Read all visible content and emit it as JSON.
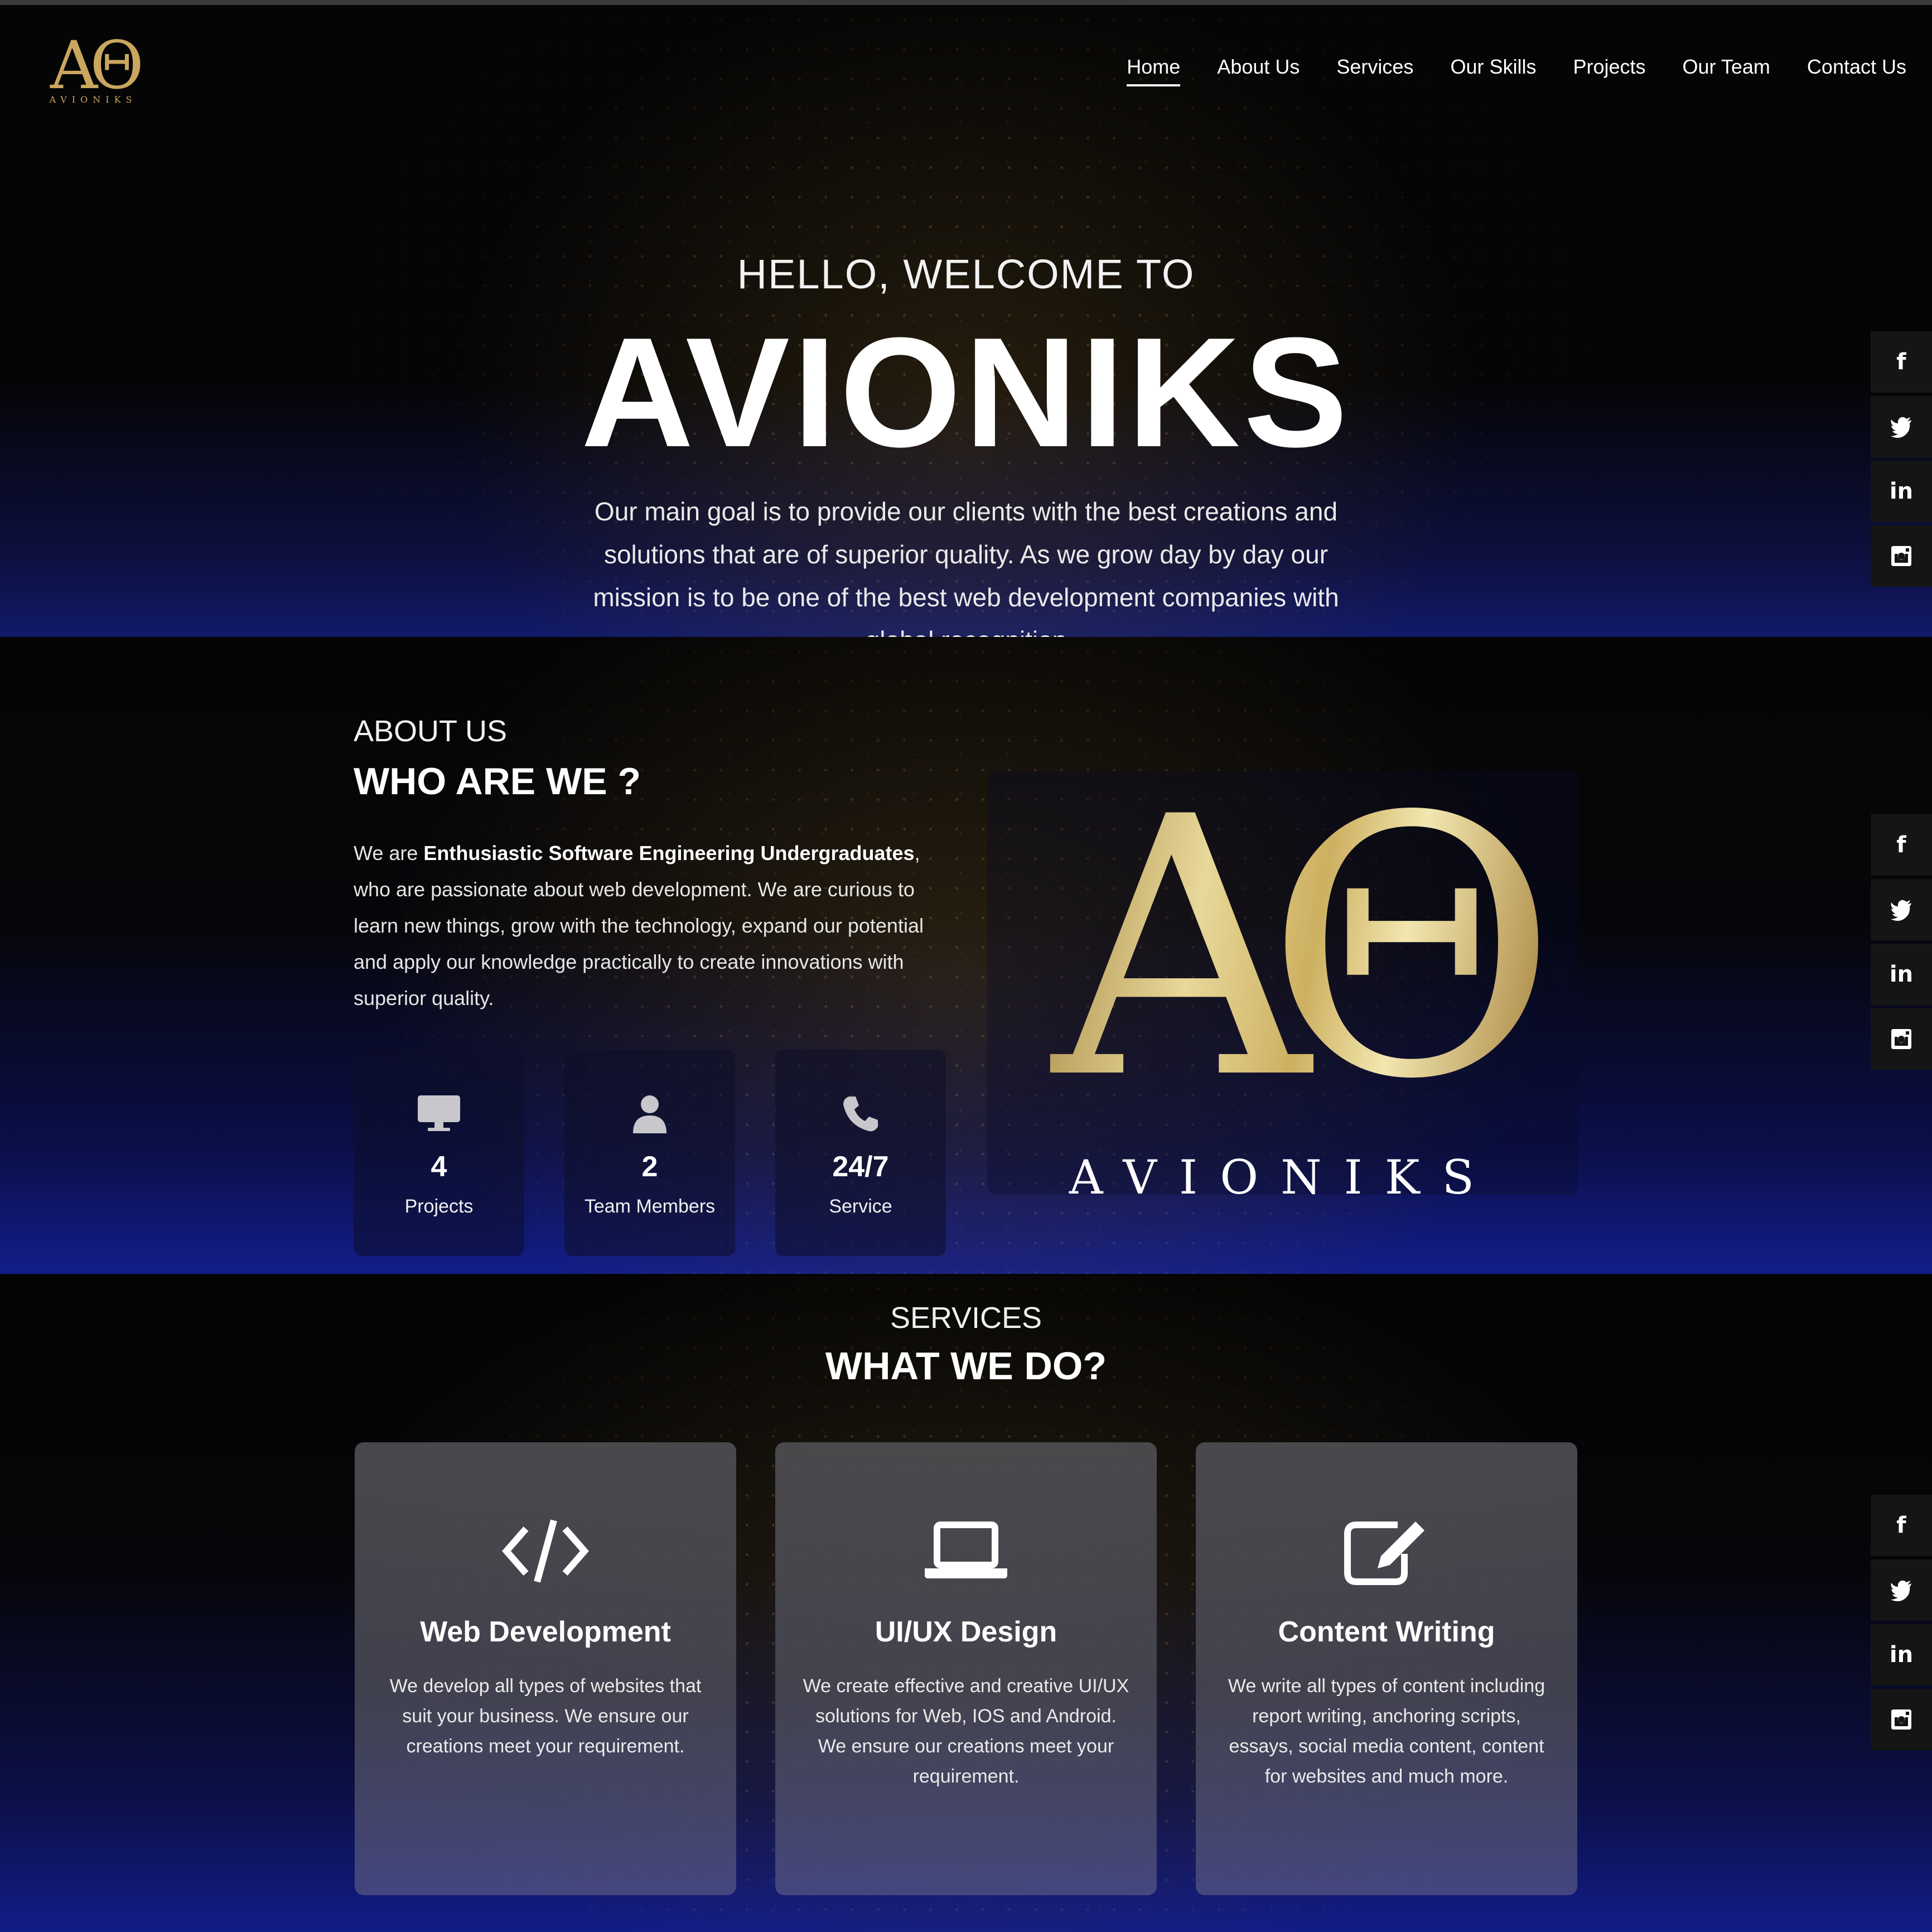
{
  "brand": {
    "mark": "AΘ",
    "word": "AVIONIKS"
  },
  "nav": [
    {
      "label": "Home",
      "active": true
    },
    {
      "label": "About Us"
    },
    {
      "label": "Services"
    },
    {
      "label": "Our Skills"
    },
    {
      "label": "Projects"
    },
    {
      "label": "Our Team"
    },
    {
      "label": "Contact Us"
    }
  ],
  "hero": {
    "subtitle": "HELLO, WELCOME TO",
    "title": "AVIONIKS",
    "text": "Our main goal is to provide our clients with the best creations and solutions that are of superior quality. As we grow day by day our mission is to be one of the best web development companies with global recognition"
  },
  "social": {
    "icons": [
      "facebook-icon",
      "twitter-icon",
      "linkedin-icon",
      "instagram-icon"
    ],
    "facebook": "f",
    "linkedin": "in"
  },
  "about": {
    "kicker": "ABOUT US",
    "title": "WHO ARE WE ?",
    "text_prefix": "We are ",
    "text_bold": "Enthusiastic Software Engineering Undergraduates",
    "text_suffix": ", who are passionate about web development. We are curious to learn new things, grow with the technology, expand our potential and apply our knowledge practically to create innovations with superior quality.",
    "stats": [
      {
        "icon": "desktop-icon",
        "value": "4",
        "label": "Projects"
      },
      {
        "icon": "user-icon",
        "value": "2",
        "label": "Team Members"
      },
      {
        "icon": "phone-icon",
        "value": "24/7",
        "label": "Service"
      }
    ],
    "logo_mark": "AΘ",
    "logo_word": "AVIONIKS"
  },
  "services": {
    "kicker": "SERVICES",
    "title": "WHAT WE DO?",
    "cards": [
      {
        "icon": "code-icon",
        "title": "Web Development",
        "text": "We develop all types of websites that suit your business. We ensure our creations meet your requirement."
      },
      {
        "icon": "laptop-icon",
        "title": "UI/UX Design",
        "text": "We create effective and creative UI/UX solutions for Web, IOS and Android. We ensure our creations meet your requirement."
      },
      {
        "icon": "edit-icon",
        "title": "Content Writing",
        "text": "We write all types of content including report writing, anchoring scripts, essays, social media content, content for websites and much more."
      }
    ]
  }
}
